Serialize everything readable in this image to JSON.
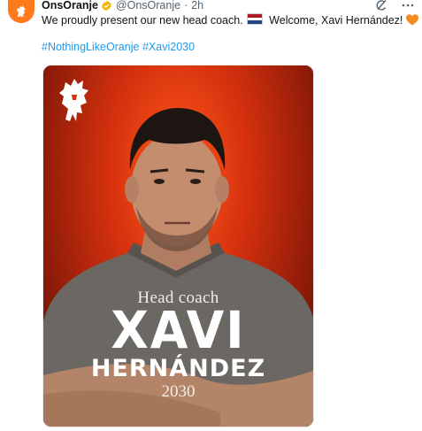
{
  "tweet": {
    "display_name": "OnsOranje",
    "handle": "@OnsOranje",
    "separator": "·",
    "time": "2h",
    "text_part1": "We proudly present our new head coach.",
    "text_part2": "Welcome, Xavi Hernández!",
    "hashtag1": "#NothingLikeOranje",
    "hashtag2": "#Xavi2030",
    "icons": {
      "avatar": "knvb-lion-logo-icon",
      "verified": "verified-badge-icon",
      "grok": "grok-icon",
      "more": "more-options-icon",
      "flag": "netherlands-flag-icon",
      "heart": "orange-heart-icon"
    },
    "colors": {
      "link": "#1d9bf0",
      "muted": "#536471",
      "oranje": "#ff7a1a",
      "verified": "#f4b400"
    }
  },
  "poster": {
    "subtitle": "Head coach",
    "first_name": "XAVI",
    "last_name": "HERNÁNDEZ",
    "year": "2030",
    "icons": {
      "crest": "lion-crest-icon"
    }
  }
}
